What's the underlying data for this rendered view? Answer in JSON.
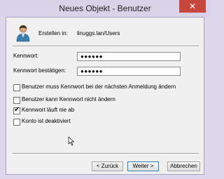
{
  "window": {
    "title": "Neues Objekt - Benutzer",
    "close_label": "✕"
  },
  "header": {
    "created_in_label": "Erstellen in:",
    "path": "linuggs.lan/Users"
  },
  "password": {
    "label": "Kennwort:",
    "value": "●●●●●●"
  },
  "confirm": {
    "label": "Kennwort bestätigen:",
    "value": "●●●●●●"
  },
  "options": [
    {
      "label": "Benutzer muss Kennwort bei der nächsten Anmeldung ändern",
      "checked": false
    },
    {
      "label": "Benutzer kann Kennwort nicht ändern",
      "checked": false
    },
    {
      "label": "Kennwort läuft nie ab",
      "checked": true
    },
    {
      "label": "Konto ist deaktiviert",
      "checked": false
    }
  ],
  "buttons": {
    "back": "< Zurück",
    "next": "Weiter >",
    "cancel": "Abbrechen"
  },
  "check_mark": "✔",
  "icons": {
    "user": "user-icon",
    "close": "close-icon",
    "cursor": "mouse-pointer-icon"
  }
}
